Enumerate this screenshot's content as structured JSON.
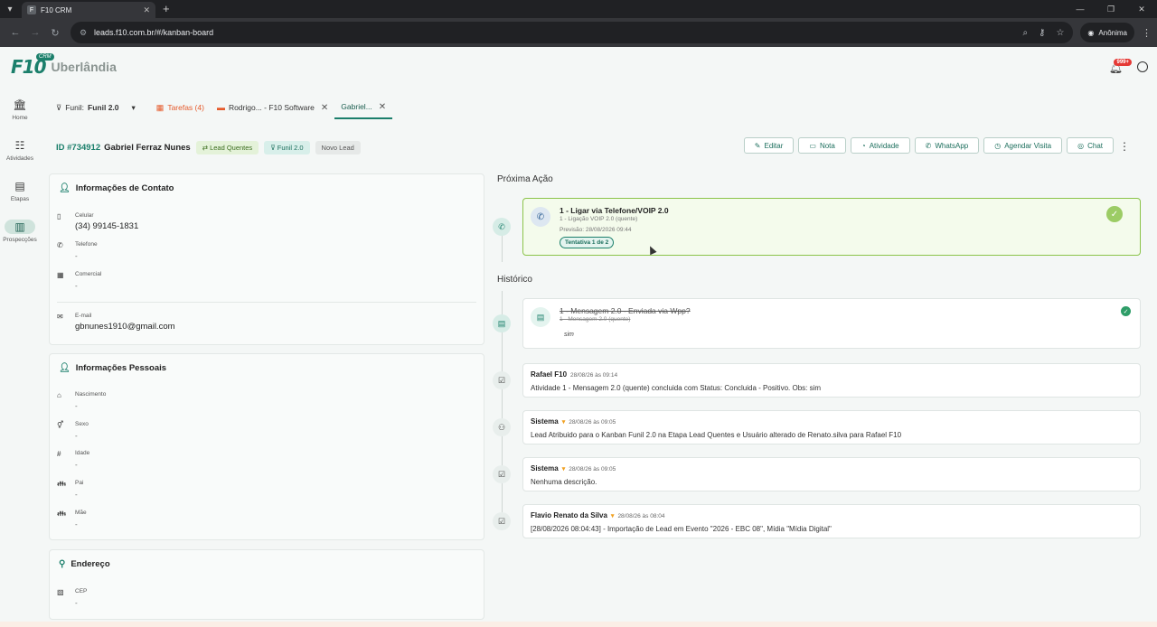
{
  "browser": {
    "tab_title": "F10 CRM",
    "tab_favicon": "F",
    "url": "leads.f10.com.br/#/kanban-board",
    "incognito_label": "Anônima"
  },
  "header": {
    "logo_text": "F10",
    "logo_badge": "CRM",
    "city": "Uberlândia",
    "notif_count": "999+"
  },
  "sidebar": {
    "items": [
      {
        "label": "Home",
        "icon": "bank-icon"
      },
      {
        "label": "Atividades",
        "icon": "checklist-icon"
      },
      {
        "label": "Etapas",
        "icon": "stages-icon"
      },
      {
        "label": "Prospecções",
        "icon": "columns-icon"
      }
    ]
  },
  "tabs": {
    "funnel_label": "Funil:",
    "funnel_value": "Funil 2.0",
    "tasks_label": "Tarefas (4)",
    "tab_rodrigo": "Rodrigo... - F10 Software",
    "tab_gabriel": "Gabriel..."
  },
  "lead": {
    "id": "ID #734912",
    "name": "Gabriel Ferraz Nunes",
    "stage_chip": "Lead Quentes",
    "funnel_chip": "Funil 2.0",
    "new_chip": "Novo Lead",
    "actions": [
      "Editar",
      "Nota",
      "Atividade",
      "WhatsApp",
      "Agendar Visita",
      "Chat"
    ]
  },
  "contact": {
    "title": "Informações de Contato",
    "cel_label": "Celular",
    "cel_value": "(34) 99145-1831",
    "tel_label": "Telefone",
    "tel_value": "-",
    "com_label": "Comercial",
    "com_value": "-",
    "email_label": "E-mail",
    "email_value": "gbnunes1910@gmail.com"
  },
  "personal": {
    "title": "Informações Pessoais",
    "birth_label": "Nascimento",
    "birth_value": "-",
    "sex_label": "Sexo",
    "sex_value": "-",
    "age_label": "Idade",
    "age_value": "-",
    "father_label": "Pai",
    "father_value": "-",
    "mother_label": "Mãe",
    "mother_value": "-"
  },
  "address": {
    "title": "Endereço",
    "cep_label": "CEP",
    "cep_value": "-"
  },
  "next_action": {
    "section_title": "Próxima Ação",
    "title": "1 - Ligar via Telefone/VOIP 2.0",
    "subtitle": "1 - Ligação VOIP 2.0 (quente)",
    "forecast": "Previsão: 28/08/2026 09:44",
    "attempt": "Tentativa 1 de 2"
  },
  "history": {
    "section_title": "Histórico",
    "completed_title": "1 - Mensagem 2.0 - Enviada via Wpp?",
    "completed_subtitle": "1 - Mensagem 2.0 (quente)",
    "completed_obs": "sim",
    "entries": [
      {
        "author": "Rafael F10",
        "time": "28/08/26 às 09:14",
        "desc": "Atividade 1 - Mensagem 2.0 (quente) concluida com Status: Concluida - Positivo. Obs: sim"
      },
      {
        "author": "Sistema",
        "time": "28/08/26 às 09:05",
        "desc": "Lead Atribuido para o Kanban Funil 2.0 na Etapa Lead Quentes e Usuário alterado de Renato.silva para Rafael F10"
      },
      {
        "author": "Sistema",
        "time": "28/08/26 às 09:05",
        "desc": "Nenhuma descrição."
      },
      {
        "author": "Flavio Renato da Silva",
        "time": "28/08/26 às 08:04",
        "desc": "[28/08/2026 08:04:43] - Importação de Lead em Evento \"2026 - EBC 08\", Mídia \"Mídia Digital\""
      }
    ]
  },
  "colors": {
    "brand": "#1b7f6b",
    "next_border": "#8bc34a",
    "tasks": "#e55a2b",
    "badge": "#e53935"
  }
}
